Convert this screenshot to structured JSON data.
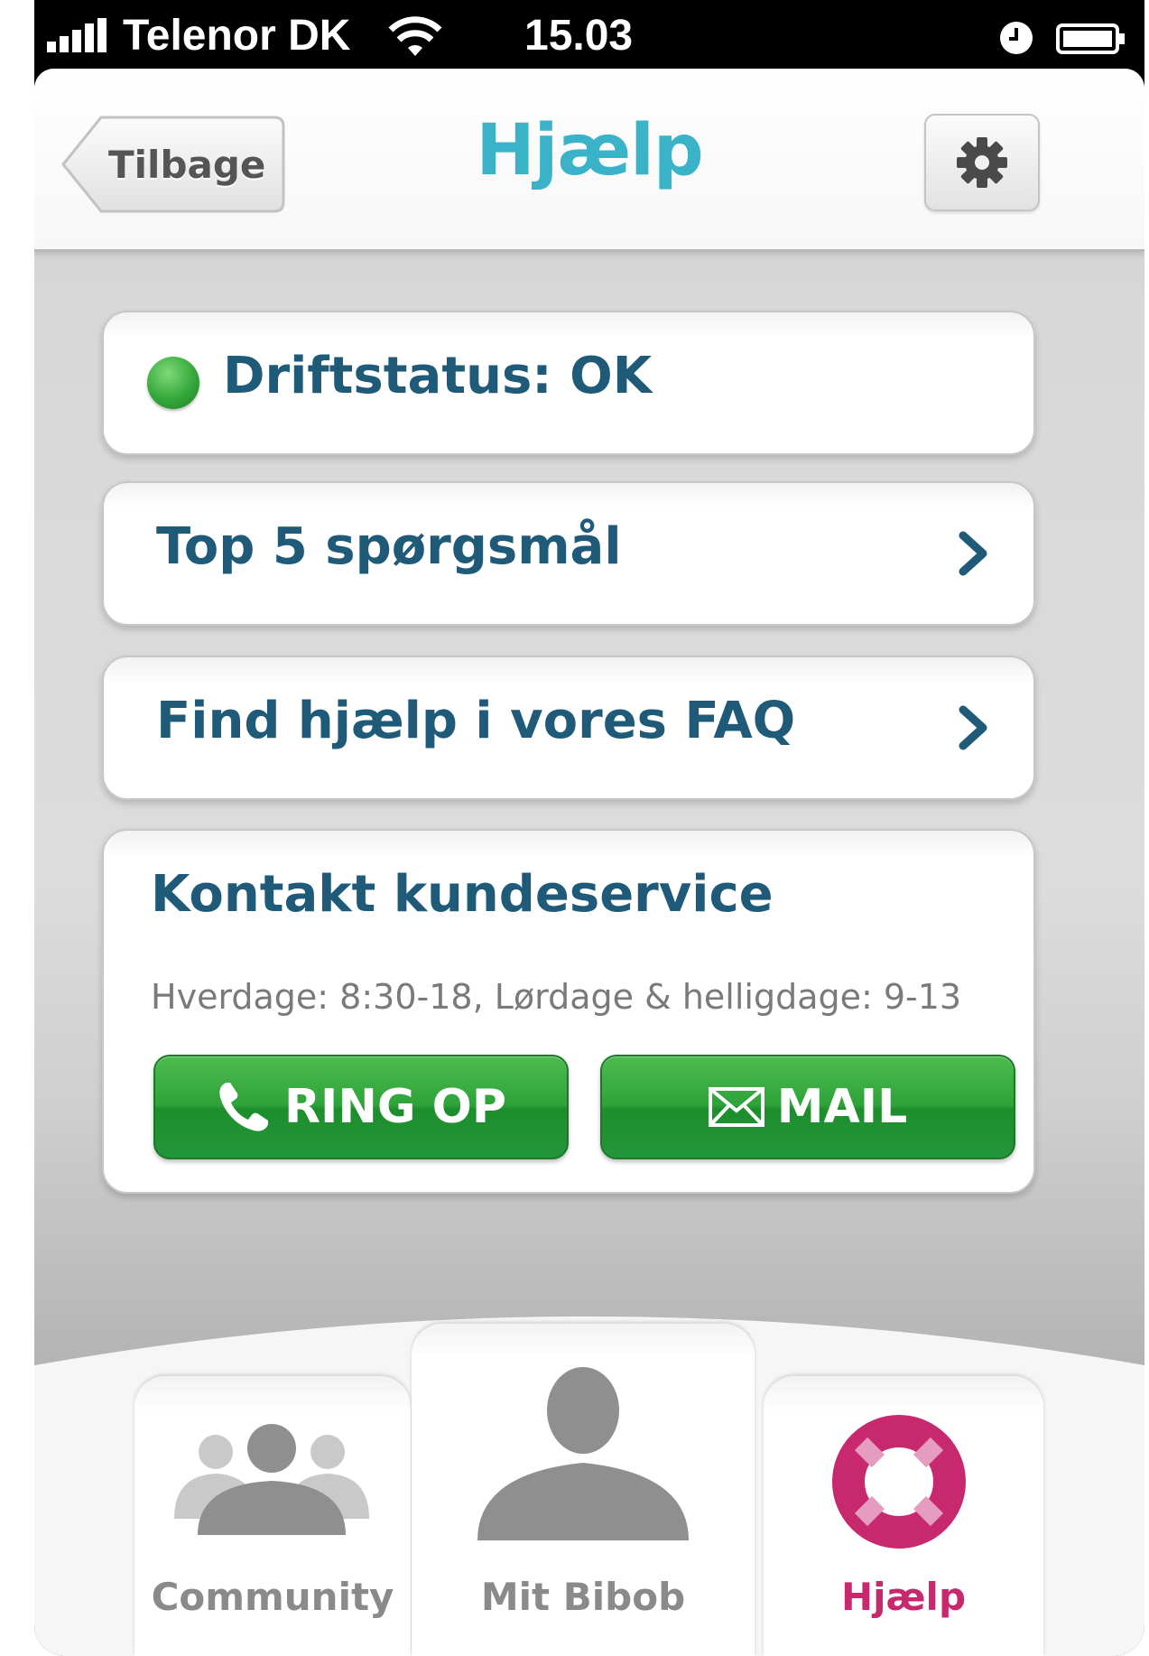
{
  "status_bar": {
    "carrier": "Telenor DK",
    "time": "15.03",
    "icons": [
      "signal-icon",
      "wifi-icon",
      "alarm-icon",
      "battery-icon"
    ]
  },
  "nav": {
    "back_label": "Tilbage",
    "title": "Hjælp",
    "settings_icon": "gear-icon"
  },
  "status": {
    "label": "Driftstatus: OK",
    "color": "#34a83a"
  },
  "menu": [
    {
      "label": "Top 5 spørgsmål",
      "icon": "chevron-right-icon"
    },
    {
      "label": "Find hjælp i vores FAQ",
      "icon": "chevron-right-icon"
    }
  ],
  "contact": {
    "title": "Kontakt kundeservice",
    "hours": "Hverdage: 8:30-18, Lørdage & helligdage: 9-13",
    "call_label": "RING OP",
    "call_icon": "phone-icon",
    "mail_label": "MAIL",
    "mail_icon": "envelope-icon"
  },
  "tabs": [
    {
      "label": "Community",
      "icon": "community-icon",
      "active": false
    },
    {
      "label": "Mit Bibob",
      "icon": "person-icon",
      "active": false
    },
    {
      "label": "Hjælp",
      "icon": "lifebuoy-icon",
      "active": true
    }
  ],
  "colors": {
    "accent": "#3ab3c8",
    "text_primary": "#1f5a78",
    "button_green": "#2ea33a",
    "active_tab": "#c8286e",
    "inactive_tab": "#8a8a8a"
  }
}
